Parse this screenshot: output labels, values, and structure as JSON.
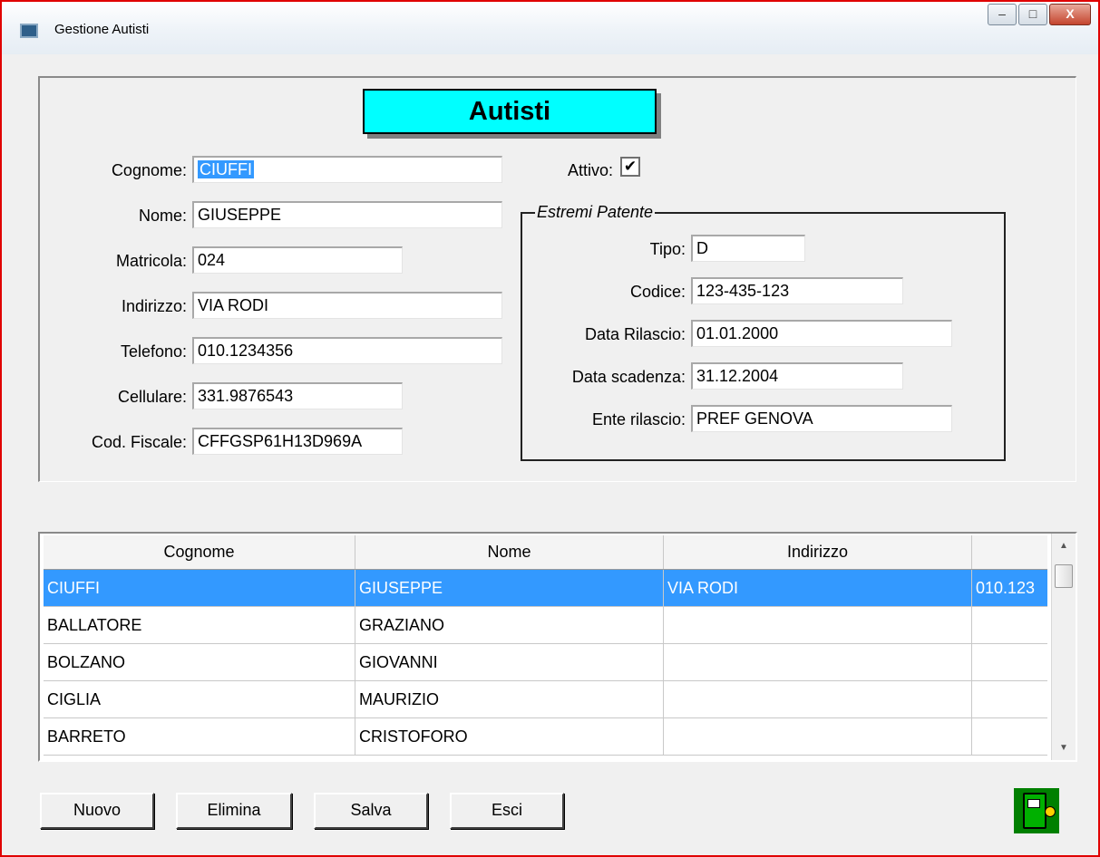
{
  "window": {
    "title": "Gestione Autisti",
    "buttons": {
      "minimize": "–",
      "maximize": "□",
      "close": "X"
    }
  },
  "form": {
    "heading": "Autisti",
    "cognome": {
      "label": "Cognome:",
      "value": "CIUFFI"
    },
    "nome": {
      "label": "Nome:",
      "value": "GIUSEPPE"
    },
    "matricola": {
      "label": "Matricola:",
      "value": "024"
    },
    "indirizzo": {
      "label": "Indirizzo:",
      "value": "VIA RODI"
    },
    "telefono": {
      "label": "Telefono:",
      "value": "010.1234356"
    },
    "cellulare": {
      "label": "Cellulare:",
      "value": "331.9876543"
    },
    "cod_fiscale": {
      "label": "Cod. Fiscale:",
      "value": "CFFGSP61H13D969A"
    },
    "attivo": {
      "label": "Attivo:",
      "checked": true,
      "mark": "✔"
    }
  },
  "patente": {
    "title": "Estremi Patente",
    "tipo": {
      "label": "Tipo:",
      "value": "D"
    },
    "codice": {
      "label": "Codice:",
      "value": "123-435-123"
    },
    "data_rilascio": {
      "label": "Data Rilascio:",
      "value": "01.01.2000"
    },
    "data_scadenza": {
      "label": "Data scadenza:",
      "value": "31.12.2004"
    },
    "ente_rilascio": {
      "label": "Ente rilascio:",
      "value": "PREF GENOVA"
    }
  },
  "table": {
    "columns": [
      "Cognome",
      "Nome",
      "Indirizzo",
      ""
    ],
    "rows": [
      [
        "CIUFFI",
        "GIUSEPPE",
        "VIA RODI",
        "010.123"
      ],
      [
        "BALLATORE",
        "GRAZIANO",
        "",
        ""
      ],
      [
        "BOLZANO",
        "GIOVANNI",
        "",
        ""
      ],
      [
        "CIGLIA",
        "MAURIZIO",
        "",
        ""
      ],
      [
        "BARRETO",
        "CRISTOFORO",
        "",
        ""
      ]
    ],
    "selected_row": 0
  },
  "buttons": {
    "nuovo": "Nuovo",
    "elimina": "Elimina",
    "salva": "Salva",
    "esci": "Esci"
  },
  "colors": {
    "heading_bg": "#00ffff",
    "selection": "#3399ff",
    "logo_bg": "#008000"
  }
}
